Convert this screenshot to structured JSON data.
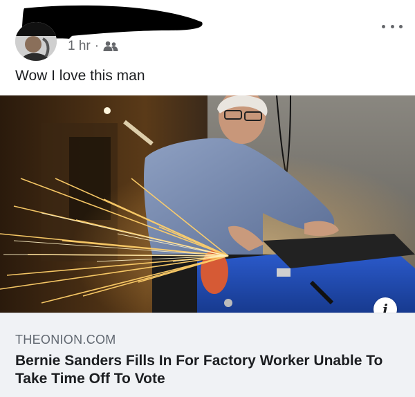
{
  "post": {
    "timestamp": "1 hr",
    "separator": "·",
    "audience_icon": "friends-icon",
    "more_icon": "more-options-icon",
    "text": "Wow I love this man"
  },
  "photo": {
    "info_glyph": "i"
  },
  "link_preview": {
    "domain": "THEONION.COM",
    "headline": "Bernie Sanders Fills In For Factory Worker Unable To Take Time Off To Vote"
  },
  "colors": {
    "meta_text": "#65676b",
    "preview_bg": "#f0f2f5",
    "redaction": "#000000"
  }
}
